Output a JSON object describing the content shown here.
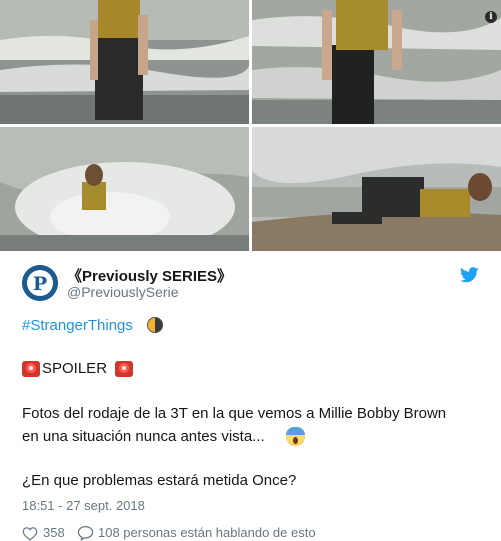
{
  "header": {
    "info_label": "i"
  },
  "photos": [
    {
      "name": "photo-standing-in-surf"
    },
    {
      "name": "photo-walking-in-surf"
    },
    {
      "name": "photo-falling-in-wave"
    },
    {
      "name": "photo-lying-on-sand"
    }
  ],
  "tweet": {
    "display_name": "《Previously SERIES》",
    "handle": "@PreviouslySerie",
    "hashtag": "#StrangerThings",
    "spoiler": "SPOILER",
    "body_line1": "Fotos del rodaje de la 3T en la que vemos a Millie Bobby Brown",
    "body_line2": "en una situación nunca antes vista...",
    "question": "¿En que problemas estará metida Once?",
    "timestamp": "18:51 - 27 sept. 2018",
    "likes": "358",
    "talking": "108 personas están hablando de esto"
  },
  "colors": {
    "link": "#1b95e0",
    "text": "#14171a",
    "secondary": "#657786",
    "twitter_blue": "#1da1f2"
  },
  "icons": [
    "info-icon",
    "twitter-bird-icon",
    "half-moon-emoji-icon",
    "siren-emoji-icon",
    "screaming-face-emoji-icon",
    "heart-icon",
    "reply-icon"
  ]
}
